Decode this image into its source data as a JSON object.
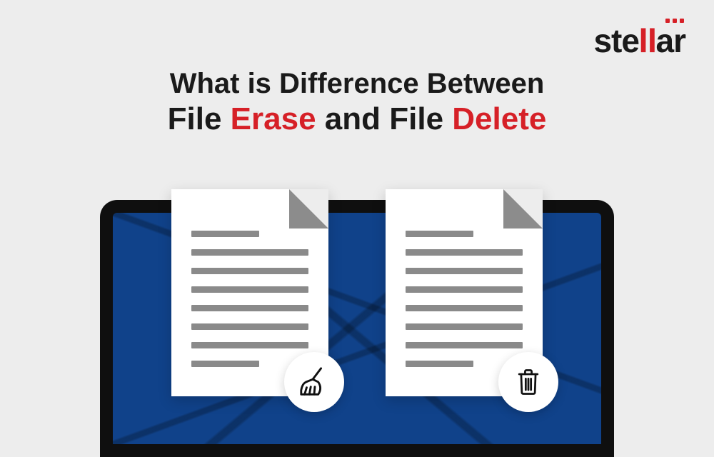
{
  "brand": {
    "name": "stellar"
  },
  "headline": {
    "line1": "What is Difference Between",
    "line2_part1": "File ",
    "line2_accent1": "Erase",
    "line2_part2": " and File ",
    "line2_accent2": "Delete"
  },
  "colors": {
    "accent": "#d62027",
    "text": "#1a1a1a",
    "bg": "#ededed",
    "screen": "#10428a"
  },
  "icons": {
    "left": "broom-icon",
    "right": "trash-icon"
  }
}
